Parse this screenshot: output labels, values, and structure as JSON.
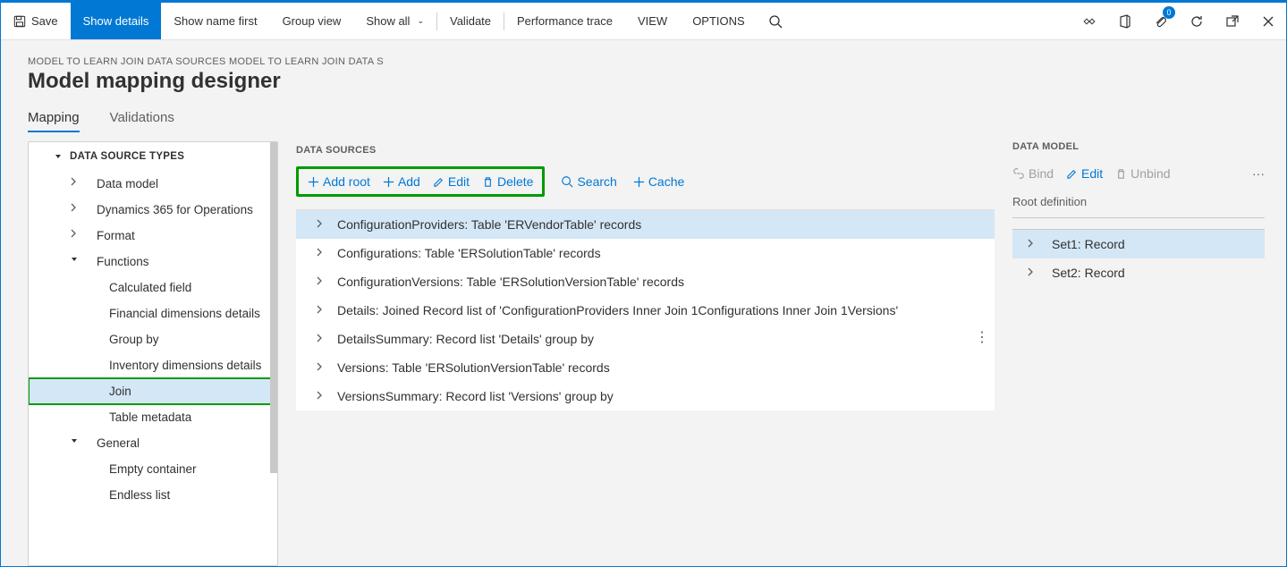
{
  "topbar": {
    "save": "Save",
    "show_details": "Show details",
    "show_name_first": "Show name first",
    "group_view": "Group view",
    "show_all": "Show all",
    "validate": "Validate",
    "perf_trace": "Performance trace",
    "view": "VIEW",
    "options": "OPTIONS",
    "badge_count": "0"
  },
  "breadcrumb": "MODEL TO LEARN JOIN DATA SOURCES MODEL TO LEARN JOIN DATA S",
  "page_title": "Model mapping designer",
  "tabs": {
    "mapping": "Mapping",
    "validations": "Validations"
  },
  "left": {
    "header": "DATA SOURCE TYPES",
    "items": [
      {
        "label": "Data model",
        "level": 1,
        "expandable": true,
        "open": false
      },
      {
        "label": "Dynamics 365 for Operations",
        "level": 1,
        "expandable": true,
        "open": false
      },
      {
        "label": "Format",
        "level": 1,
        "expandable": true,
        "open": false
      },
      {
        "label": "Functions",
        "level": 1,
        "expandable": true,
        "open": true
      },
      {
        "label": "Calculated field",
        "level": 2,
        "expandable": false
      },
      {
        "label": "Financial dimensions details",
        "level": 2,
        "expandable": false
      },
      {
        "label": "Group by",
        "level": 2,
        "expandable": false
      },
      {
        "label": "Inventory dimensions details",
        "level": 2,
        "expandable": false
      },
      {
        "label": "Join",
        "level": 2,
        "expandable": false,
        "selected": true,
        "highlight": true
      },
      {
        "label": "Table metadata",
        "level": 2,
        "expandable": false
      },
      {
        "label": "General",
        "level": 1,
        "expandable": true,
        "open": true
      },
      {
        "label": "Empty container",
        "level": 2,
        "expandable": false
      },
      {
        "label": "Endless list",
        "level": 2,
        "expandable": false
      }
    ]
  },
  "mid": {
    "header": "DATA SOURCES",
    "actions": {
      "add_root": "Add root",
      "add": "Add",
      "edit": "Edit",
      "delete": "Delete",
      "search": "Search",
      "cache": "Cache"
    },
    "items": [
      {
        "label": "ConfigurationProviders: Table 'ERVendorTable' records",
        "selected": true
      },
      {
        "label": "Configurations: Table 'ERSolutionTable' records"
      },
      {
        "label": "ConfigurationVersions: Table 'ERSolutionVersionTable' records"
      },
      {
        "label": "Details: Joined Record list of 'ConfigurationProviders Inner Join 1Configurations Inner Join 1Versions'"
      },
      {
        "label": "DetailsSummary: Record list 'Details' group by"
      },
      {
        "label": "Versions: Table 'ERSolutionVersionTable' records"
      },
      {
        "label": "VersionsSummary: Record list 'Versions' group by"
      }
    ]
  },
  "right": {
    "header": "DATA MODEL",
    "actions": {
      "bind": "Bind",
      "edit": "Edit",
      "unbind": "Unbind"
    },
    "root_label": "Root definition",
    "items": [
      {
        "label": "Set1: Record",
        "selected": true
      },
      {
        "label": "Set2: Record"
      }
    ]
  }
}
